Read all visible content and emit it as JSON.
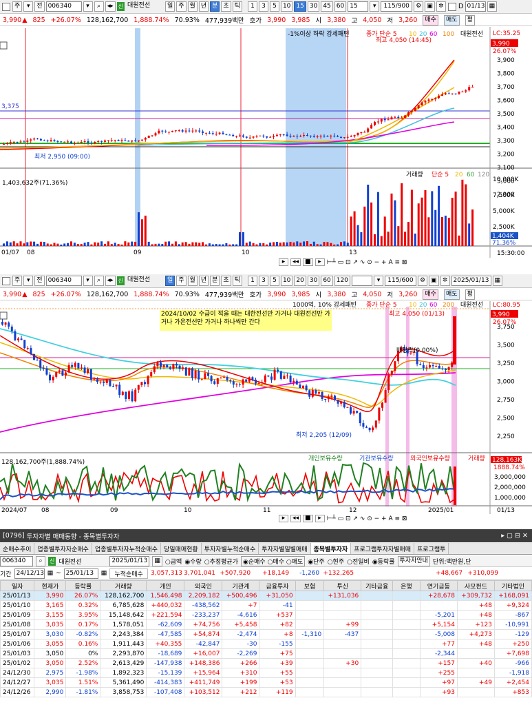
{
  "toolbar1": {
    "type": "주",
    "mode": "전",
    "code": "006340",
    "name": "대원전선",
    "tabs": [
      "일",
      "주",
      "월",
      "년",
      "분",
      "초",
      "틱"
    ],
    "intervals": [
      "1",
      "3",
      "5",
      "10",
      "15",
      "30",
      "45",
      "60"
    ],
    "interval_sel": "15",
    "count": "15",
    "range": "115/900",
    "date": "01/13",
    "checkbox_d": "D"
  },
  "quote": {
    "price": "3,990",
    "change": "825",
    "pct": "+26.07%",
    "volume": "128,162,700",
    "vol_pct": "1,888.74%",
    "turn": "70.93%",
    "amount": "477,939백만",
    "hoga_label": "호가",
    "hoga1": "3,990",
    "hoga2": "3,985",
    "open_label": "시",
    "open": "3,380",
    "high_label": "고",
    "high": "4,050",
    "low_label": "저",
    "low": "3,260",
    "buy": "매수",
    "sell": "매도",
    "flat": "평"
  },
  "chart1": {
    "legend": "-1%이상 하락 강세패턴",
    "ma_label": "종가 단순 5",
    "ma_vals": [
      "10",
      "20",
      "60",
      "100"
    ],
    "ma_colors": [
      "#e00000",
      "#f0b800",
      "#40c0e0",
      "#e000e0",
      "#f08000"
    ],
    "stock": "대원전선",
    "lc": "LC:35.25",
    "cur_price": "3,990",
    "cur_pct": "26.07%",
    "high_note": "최고 4,050 (14:45)",
    "low_note": "최저 2,950 (09:00)",
    "level1": "3,375",
    "yticks": [
      "3,900",
      "3,800",
      "3,700",
      "3,600",
      "3,500",
      "3,400",
      "3,300",
      "3,200",
      "3,100",
      "3,000",
      "2,900"
    ],
    "vol_title": "거래량",
    "vol_ma": [
      "단순 5",
      "20",
      "60",
      "120"
    ],
    "vol_info": "1,403,632주(71.36%)",
    "vol_ticks": [
      "10,000K",
      "7,500K",
      "5,000K",
      "2,500K"
    ],
    "vol_cur": "1,404K",
    "vol_pct": "71.36%",
    "dates": [
      "01/07",
      "08",
      "09",
      "10",
      "13"
    ],
    "time": "15:30:00"
  },
  "toolbar2": {
    "type": "주",
    "mode": "전",
    "code": "006340",
    "name": "대원전선",
    "tabs": [
      "일",
      "주",
      "월",
      "년",
      "분",
      "초",
      "틱"
    ],
    "intervals": [
      "1",
      "3",
      "5",
      "10",
      "20",
      "30",
      "60",
      "120"
    ],
    "range": "115/600",
    "date": "2025/01/13"
  },
  "chart2": {
    "legend": "1000억, 10% 강세패턴",
    "ma_label": "종가 단순 5",
    "ma_vals": [
      "10",
      "20",
      "60",
      "200"
    ],
    "stock": "대원전선",
    "lc": "LC:80.95",
    "cur_price": "3,990",
    "cur_pct": "26.07%",
    "note": "2024/10/02 수급이 적을 때는 대한전선만 가거나 대원전선만 가거나 가온전선만 가거나 하나씩만 간다",
    "high_note": "최고 4,050 (01/13)",
    "low_note": "최저 2,205 (12/09)",
    "mid_note": "배당락(0.00%)",
    "yticks": [
      "3,750",
      "3,500",
      "3,250",
      "3,000",
      "2,750",
      "2,500",
      "2,250"
    ],
    "sub_legend": [
      "개인보유수량",
      "기관보유수량",
      "외국인보유수량",
      "거래량"
    ],
    "sub_info": "128,162,700주(1,888.74%)",
    "sub_cur": "128,163K",
    "sub_pct": "1888.74%",
    "sub_ticks": [
      "3,000,000",
      "2,000,000",
      "1,000,000"
    ],
    "dates": [
      "2024/07",
      "08",
      "09",
      "10",
      "11",
      "12",
      "2025/01"
    ],
    "date_end": "01/13"
  },
  "panel": {
    "id": "[0796]",
    "title": "투자자별 매매동향 - 종목별투자자",
    "tabs": [
      "순매수추이",
      "업종별투자자순매수",
      "업종별투자자누적순매수",
      "당일매매현황",
      "투자자별누적순매수",
      "투자자별일별매매",
      "종목별투자자",
      "프로그램투자자별매매",
      "프로그램투"
    ],
    "active_tab": "종목별투자자",
    "code": "006340",
    "name": "대원전선",
    "date": "2025/01/13",
    "opts": [
      "금액",
      "수량",
      "추정평균가",
      "순매수",
      "매수",
      "매도",
      "단주",
      "현주",
      "전일비",
      "등락률",
      "투자자안내"
    ],
    "unit": "단위:백만원,단",
    "period_from": "24/12/13",
    "period_to": "25/01/13",
    "sum_label": "누적순매수",
    "sums": [
      "3,057,313",
      "3,701,041",
      "+507,920",
      "+18,149",
      "-1,260",
      "+132,265",
      "",
      "",
      "+48,667",
      "+310,099"
    ],
    "cols": [
      "일자",
      "현재가",
      "등락률",
      "거래량",
      "개인",
      "외국인",
      "기관계",
      "금융투자",
      "보험",
      "투신",
      "기타금융",
      "은행",
      "연기금등",
      "사모펀드",
      "기타법인"
    ],
    "rows": [
      [
        "25/01/13",
        "3,990",
        "26.07%",
        "128,162,700",
        "1,546,498",
        "2,209,182",
        "+500,496",
        "+31,050",
        "",
        "+131,036",
        "",
        "",
        "+28,678",
        "+309,732",
        "+168,091"
      ],
      [
        "25/01/10",
        "3,165",
        "0.32%",
        "6,785,628",
        "+440,032",
        "-438,562",
        "+7",
        "-41",
        "",
        "",
        "",
        "",
        "",
        "+48",
        "+9,324"
      ],
      [
        "25/01/09",
        "3,155",
        "3.95%",
        "15,148,642",
        "+221,594",
        "-233,237",
        "-4,616",
        "+537",
        "",
        "",
        "",
        "",
        "-5,201",
        "+48",
        "-867"
      ],
      [
        "25/01/08",
        "3,035",
        "0.17%",
        "1,578,051",
        "-62,609",
        "+74,756",
        "+5,458",
        "+82",
        "",
        "+99",
        "",
        "",
        "+5,154",
        "+123",
        "-10,991"
      ],
      [
        "25/01/07",
        "3,030",
        "-0.82%",
        "2,243,384",
        "-47,585",
        "+54,874",
        "-2,474",
        "+8",
        "-1,310",
        "-437",
        "",
        "",
        "-5,008",
        "+4,273",
        "-129"
      ],
      [
        "25/01/06",
        "3,055",
        "0.16%",
        "1,911,443",
        "+40,355",
        "-42,847",
        "-30",
        "-155",
        "",
        "",
        "",
        "",
        "+77",
        "+48",
        "+250"
      ],
      [
        "25/01/03",
        "3,050",
        "0%",
        "2,293,870",
        "-18,689",
        "+16,007",
        "-2,269",
        "+75",
        "",
        "",
        "",
        "",
        "-2,344",
        "",
        "+7,698"
      ],
      [
        "25/01/02",
        "3,050",
        "2.52%",
        "2,613,429",
        "-147,938",
        "+148,386",
        "+266",
        "+39",
        "",
        "+30",
        "",
        "",
        "+157",
        "+40",
        "-966"
      ],
      [
        "24/12/30",
        "2,975",
        "-1.98%",
        "1,892,323",
        "-15,139",
        "+15,964",
        "+310",
        "+55",
        "",
        "",
        "",
        "",
        "+255",
        "",
        "-1,918"
      ],
      [
        "24/12/27",
        "3,035",
        "1.51%",
        "5,361,490",
        "-414,383",
        "+411,749",
        "+199",
        "+53",
        "",
        "",
        "",
        "",
        "+97",
        "+49",
        "+2,454"
      ],
      [
        "24/12/26",
        "2,990",
        "-1.81%",
        "3,858,753",
        "-107,408",
        "+103,512",
        "+212",
        "+119",
        "",
        "",
        "",
        "",
        "+93",
        "",
        "+853"
      ]
    ]
  }
}
